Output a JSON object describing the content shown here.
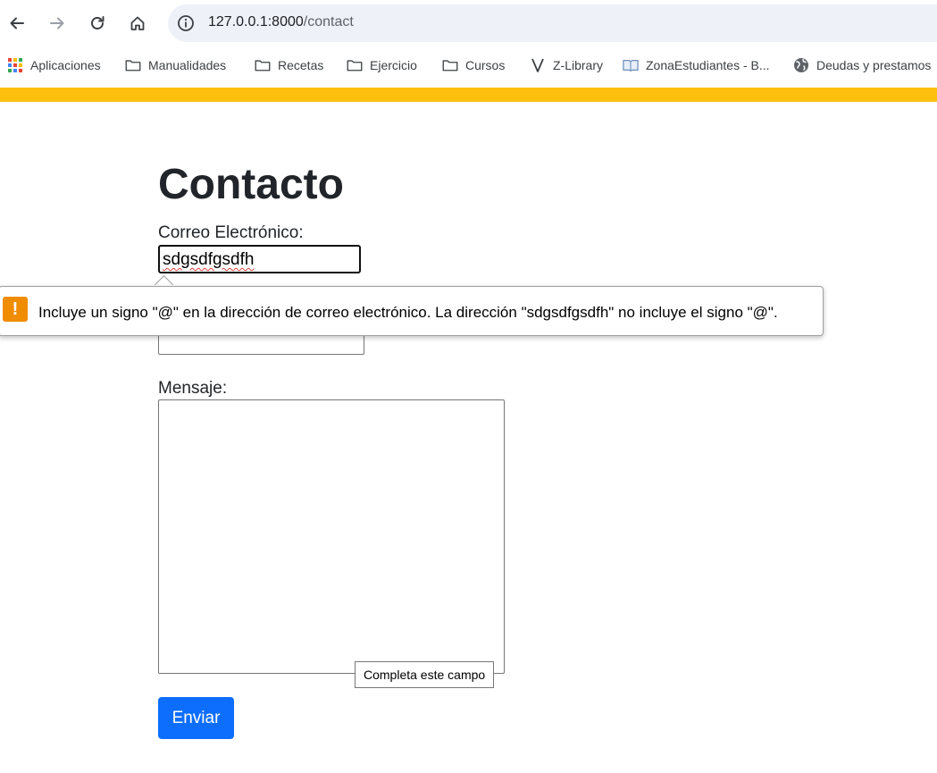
{
  "browser": {
    "url_host": "127.0.0.1:8000",
    "url_path": "/contact",
    "bookmarks": [
      {
        "label": "Aplicaciones",
        "icon": "apps-grid-icon"
      },
      {
        "label": "Manualidades",
        "icon": "folder-icon"
      },
      {
        "label": "Recetas",
        "icon": "folder-icon"
      },
      {
        "label": "Ejercicio",
        "icon": "folder-icon"
      },
      {
        "label": "Cursos",
        "icon": "folder-icon"
      },
      {
        "label": "Z-Library",
        "icon": "zlibrary-icon"
      },
      {
        "label": "ZonaEstudiantes - B...",
        "icon": "book-icon"
      },
      {
        "label": "Deudas y prestamos",
        "icon": "globe-icon"
      }
    ]
  },
  "page": {
    "title": "Contacto",
    "email_label": "Correo Electrónico:",
    "email_value": "sdgsdfgsdfh",
    "message_label": "Mensaje:",
    "send_label": "Enviar",
    "accent_color": "#fdc00f",
    "button_color": "#0d6efd"
  },
  "validation": {
    "bubble_icon": "!",
    "bubble_text": "Incluye un signo \"@\" en la dirección de correo electrónico. La dirección \"sdgsdfgsdfh\" no incluye el signo \"@\".",
    "tooltip_text": "Completa este campo",
    "warning_color": "#f08c00"
  }
}
